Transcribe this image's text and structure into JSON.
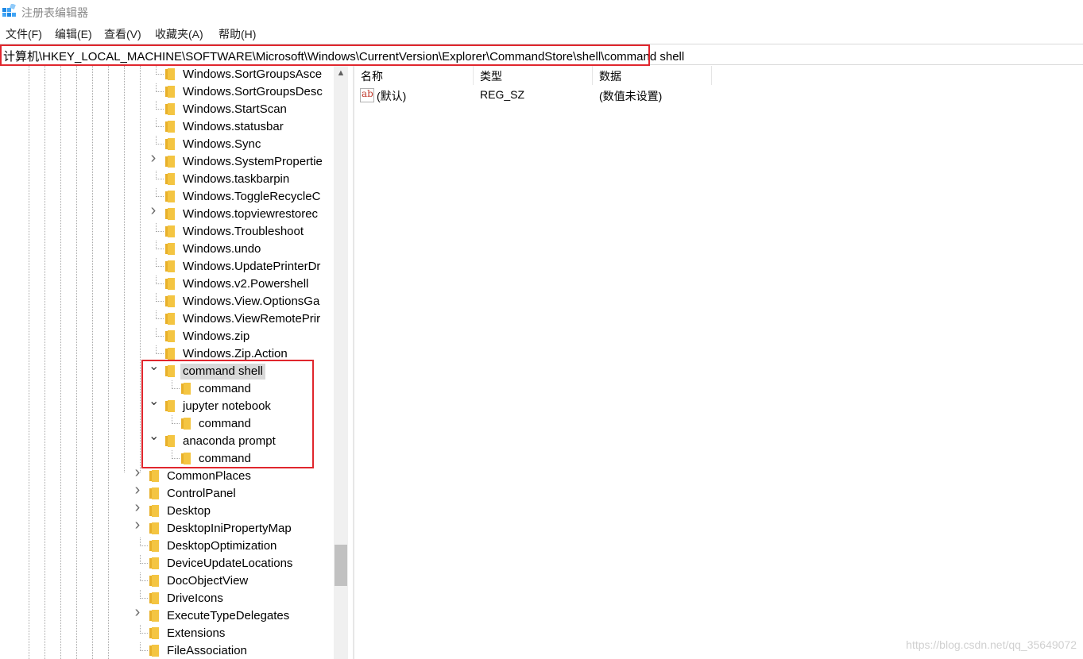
{
  "window": {
    "title": "注册表编辑器"
  },
  "menu": [
    "文件(F)",
    "编辑(E)",
    "查看(V)",
    "收藏夹(A)",
    "帮助(H)"
  ],
  "address": {
    "path": "计算机\\HKEY_LOCAL_MACHINE\\SOFTWARE\\Microsoft\\Windows\\CurrentVersion\\Explorer\\CommandStore\\shell\\command shell"
  },
  "tree": {
    "items": [
      {
        "label": "Windows.SortGroupsAsce",
        "expandable": false
      },
      {
        "label": "Windows.SortGroupsDesc",
        "expandable": false
      },
      {
        "label": "Windows.StartScan",
        "expandable": false
      },
      {
        "label": "Windows.statusbar",
        "expandable": false
      },
      {
        "label": "Windows.Sync",
        "expandable": false
      },
      {
        "label": "Windows.SystemPropertie",
        "expandable": true
      },
      {
        "label": "Windows.taskbarpin",
        "expandable": false
      },
      {
        "label": "Windows.ToggleRecycleC",
        "expandable": false
      },
      {
        "label": "Windows.topviewrestorec",
        "expandable": true
      },
      {
        "label": "Windows.Troubleshoot",
        "expandable": false
      },
      {
        "label": "Windows.undo",
        "expandable": false
      },
      {
        "label": "Windows.UpdatePrinterDr",
        "expandable": false
      },
      {
        "label": "Windows.v2.Powershell",
        "expandable": false
      },
      {
        "label": "Windows.View.OptionsGa",
        "expandable": false
      },
      {
        "label": "Windows.ViewRemotePrir",
        "expandable": false
      },
      {
        "label": "Windows.zip",
        "expandable": false
      },
      {
        "label": "Windows.Zip.Action",
        "expandable": false
      },
      {
        "label": "command shell",
        "expandable": true,
        "expanded": true,
        "selected": true
      },
      {
        "label": "command",
        "child": true
      },
      {
        "label": "jupyter notebook",
        "expandable": true,
        "expanded": true
      },
      {
        "label": "command",
        "child": true
      },
      {
        "label": "anaconda prompt",
        "expandable": true,
        "expanded": true
      },
      {
        "label": "command",
        "child": true
      },
      {
        "label": "CommonPlaces",
        "expandable": true
      },
      {
        "label": "ControlPanel",
        "expandable": true
      },
      {
        "label": "Desktop",
        "expandable": true
      },
      {
        "label": "DesktopIniPropertyMap",
        "expandable": true
      },
      {
        "label": "DesktopOptimization",
        "expandable": false
      },
      {
        "label": "DeviceUpdateLocations",
        "expandable": false
      },
      {
        "label": "DocObjectView",
        "expandable": false
      },
      {
        "label": "DriveIcons",
        "expandable": false
      },
      {
        "label": "ExecuteTypeDelegates",
        "expandable": true
      },
      {
        "label": "Extensions",
        "expandable": false
      },
      {
        "label": "FileAssociation",
        "expandable": false
      }
    ]
  },
  "values": {
    "columns": [
      "名称",
      "类型",
      "数据"
    ],
    "rows": [
      {
        "name": "(默认)",
        "type": "REG_SZ",
        "data": "(数值未设置)",
        "icon": "string-value-icon"
      }
    ]
  },
  "watermark": "https://blog.csdn.net/qq_35649072",
  "colors": {
    "highlight_border": "#e0262d",
    "folder": "#f4c542",
    "selected_bg": "#d9d9d9"
  }
}
